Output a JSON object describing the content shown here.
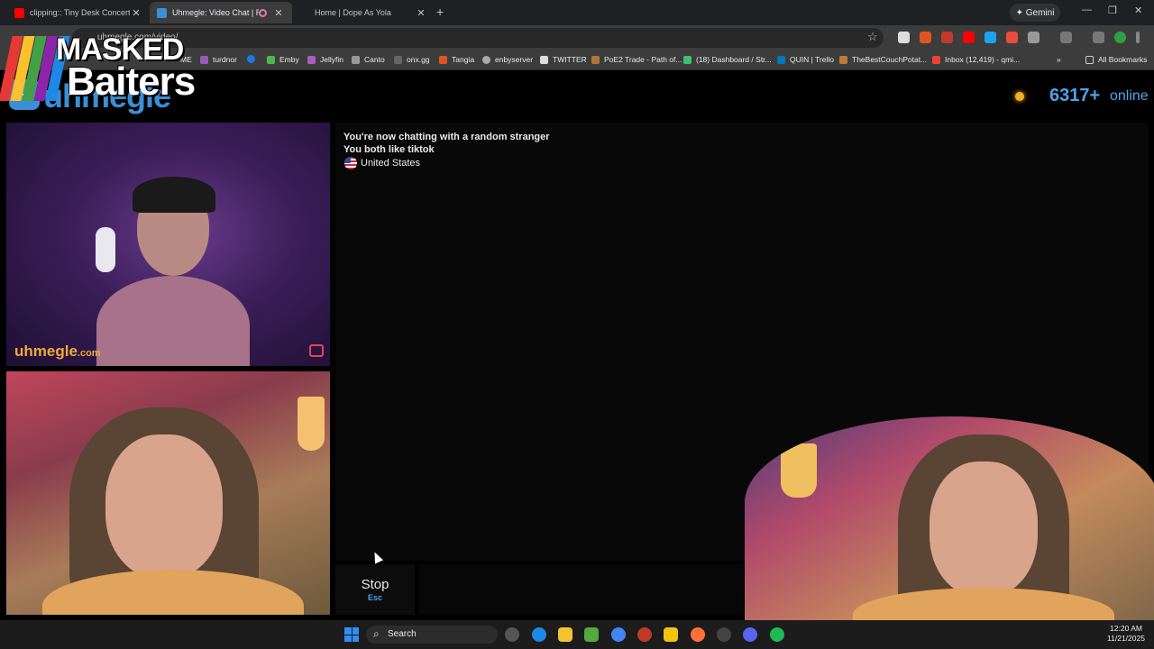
{
  "browser": {
    "tabs": [
      {
        "label": "clipping:: Tiny Desk Concert - Y",
        "icon": "youtube-icon",
        "color": "#ff0000"
      },
      {
        "label": "Uhmegle: Video Chat | Ran",
        "icon": "uhmegle-icon",
        "color": "#3a8fd6"
      },
      {
        "label": "Home | Dope As Yola",
        "icon": "page-icon",
        "color": "#888888"
      }
    ],
    "gemini_label": "Gemini",
    "url": "uhmegle.com/video/"
  },
  "bookmarks": [
    {
      "label": "ME",
      "color": "#888888"
    },
    {
      "label": "turdnor",
      "color": "#9b59b6"
    },
    {
      "label": "",
      "color": "#1877f2"
    },
    {
      "label": "Emby",
      "color": "#52b54b"
    },
    {
      "label": "Jellyfin",
      "color": "#aa5cc3"
    },
    {
      "label": "Canto",
      "color": "#999999"
    },
    {
      "label": "onx.gg",
      "color": "#666666"
    },
    {
      "label": "Tangia",
      "color": "#e2541f"
    },
    {
      "label": "enbyserver",
      "color": "#aaaaaa"
    },
    {
      "label": "TWITTER",
      "color": "#dddddd"
    },
    {
      "label": "PoE2 Trade - Path of...",
      "color": "#b0743a"
    },
    {
      "label": "(18) Dashboard / Str...",
      "color": "#3fbf6f"
    },
    {
      "label": "QUIN | Trello",
      "color": "#0079bf"
    },
    {
      "label": "TheBestCouchPotat...",
      "color": "#c07a3a"
    },
    {
      "label": "Inbox (12,419) - qmi...",
      "color": "#ea4335"
    }
  ],
  "all_bookmarks_label": "All Bookmarks",
  "overlay": {
    "line1": "MASKED",
    "line2": "Baiters"
  },
  "site": {
    "logo_text": "uhmegle",
    "online_count": "6317+",
    "online_label": "online"
  },
  "stranger_video": {
    "watermark": "uhmegle",
    "watermark_suffix": ".com"
  },
  "chat": {
    "line1": "You're now chatting with a random stranger",
    "line2": "You both like tiktok",
    "country": "United States"
  },
  "controls": {
    "stop_label": "Stop",
    "stop_hint": "Esc"
  },
  "taskbar": {
    "search_label": "Search",
    "time": "12:20 AM",
    "date": "11/21/2025"
  }
}
